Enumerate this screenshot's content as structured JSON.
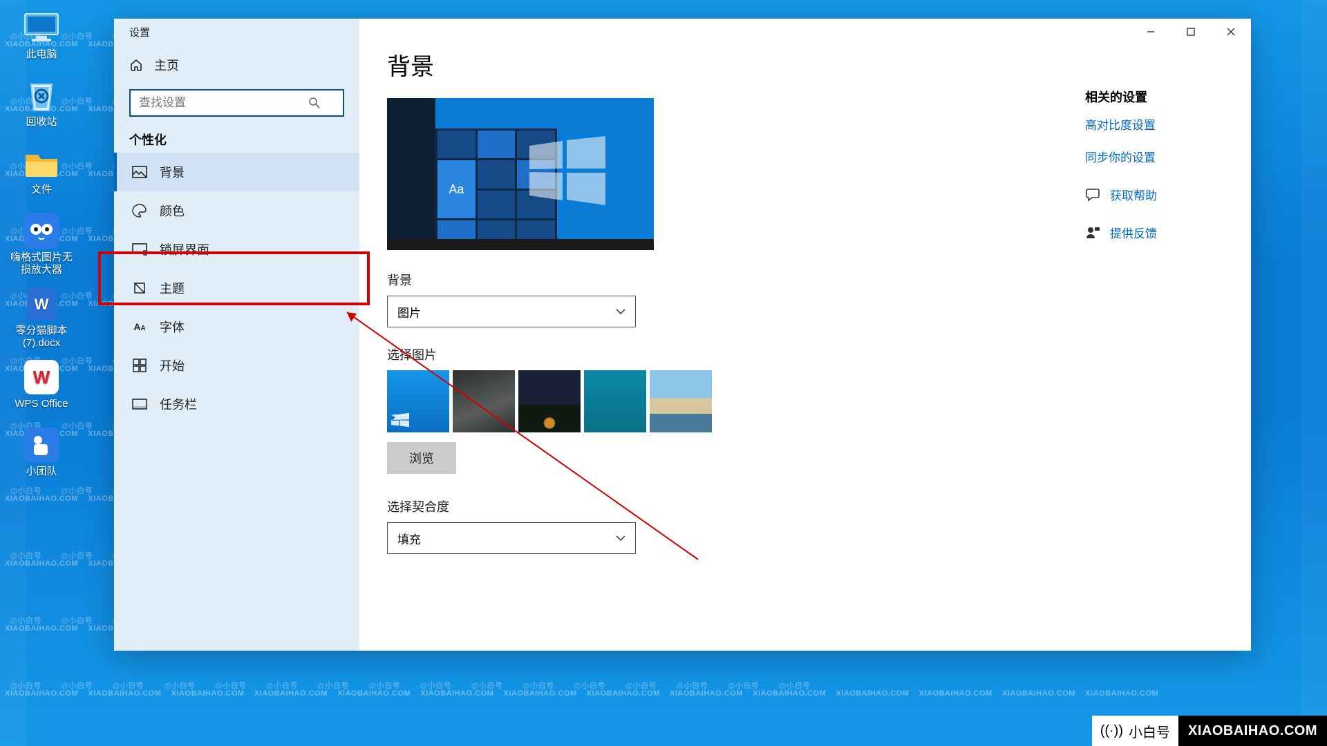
{
  "desktop_icons": [
    {
      "id": "this-pc",
      "label": "此电脑"
    },
    {
      "id": "recycle-bin",
      "label": "回收站"
    },
    {
      "id": "folder-files",
      "label": "文件"
    },
    {
      "id": "img-enlarger",
      "label": "嗨格式图片无\n损放大器"
    },
    {
      "id": "docx-file",
      "label": "零分猫脚本\n(7).docx"
    },
    {
      "id": "wps-office",
      "label": "WPS Office"
    },
    {
      "id": "xiaotuandui",
      "label": "小团队"
    }
  ],
  "window": {
    "title": "设置",
    "home": "主页",
    "search_placeholder": "查找设置",
    "category": "个性化",
    "nav": [
      {
        "id": "background",
        "label": "背景",
        "active": true
      },
      {
        "id": "colors",
        "label": "颜色"
      },
      {
        "id": "lockscreen",
        "label": "锁屏界面"
      },
      {
        "id": "themes",
        "label": "主题"
      },
      {
        "id": "fonts",
        "label": "字体"
      },
      {
        "id": "start",
        "label": "开始"
      },
      {
        "id": "taskbar",
        "label": "任务栏"
      }
    ]
  },
  "content": {
    "heading": "背景",
    "preview_sample": "Aa",
    "bg_label": "背景",
    "bg_value": "图片",
    "choose_label": "选择图片",
    "browse": "浏览",
    "fit_label": "选择契合度",
    "fit_value": "填充"
  },
  "related": {
    "heading": "相关的设置",
    "links": [
      "高对比度设置",
      "同步你的设置"
    ],
    "help": "获取帮助",
    "feedback": "提供反馈"
  },
  "watermark_small": "@小白号",
  "watermark_big": "XIAOBAIHAO.COM",
  "badge": {
    "left": "小白号",
    "right": "XIAOBAIHAO.COM"
  }
}
